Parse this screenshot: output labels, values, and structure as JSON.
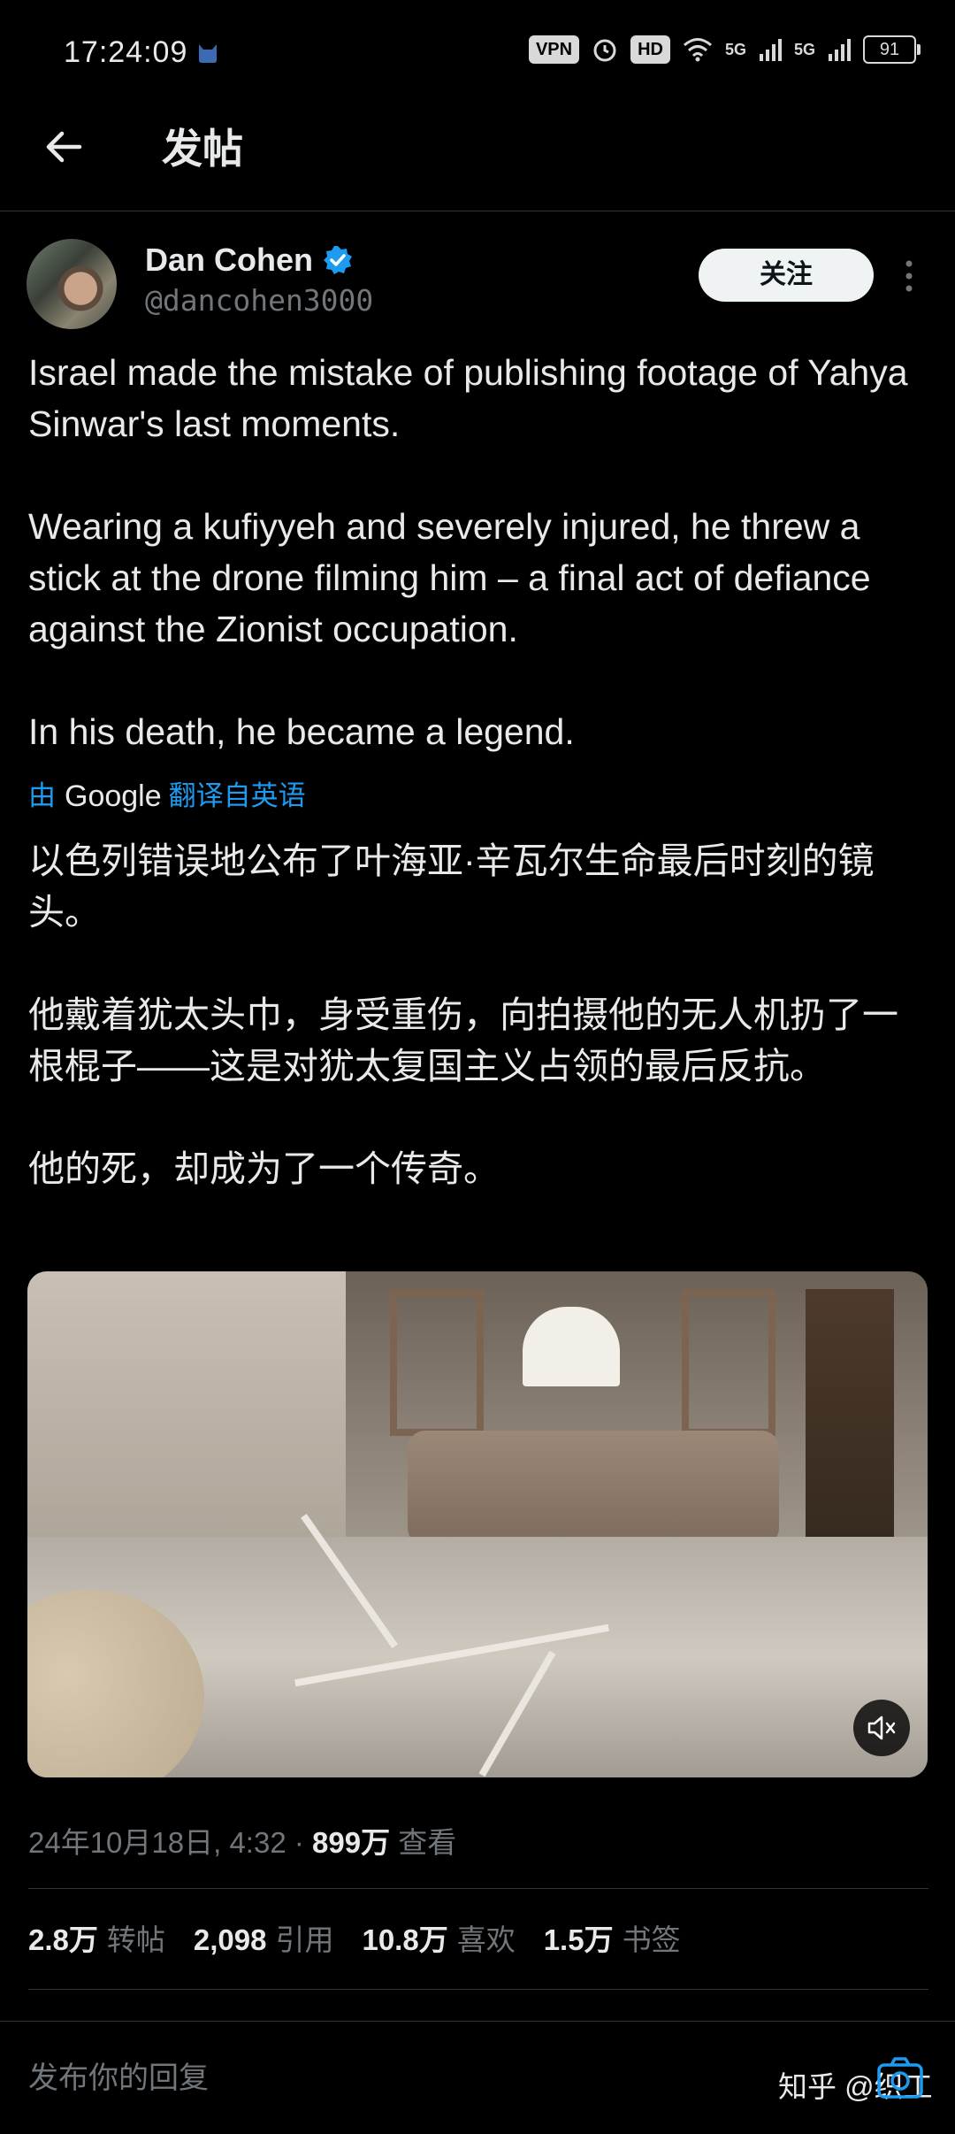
{
  "status_bar": {
    "time": "17:24:09",
    "vpn": "VPN",
    "hd": "HD",
    "signal1": "5G",
    "signal2": "5G",
    "battery": "91"
  },
  "header": {
    "title": "发帖"
  },
  "author": {
    "name": "Dan Cohen",
    "handle": "@dancohen3000",
    "follow_label": "关注"
  },
  "tweet": {
    "paragraphs": [
      "Israel made the mistake of publishing footage of Yahya Sinwar's last moments.",
      "Wearing a kufiyyeh and severely injured, he threw a stick at the drone filming him – a final act of defiance against the Zionist occupation.",
      "In his death, he became a legend."
    ]
  },
  "translation": {
    "prefix": "由",
    "brand": "Google",
    "suffix": "翻译自英语",
    "paragraphs": [
      "以色列错误地公布了叶海亚·辛瓦尔生命最后时刻的镜头。",
      "他戴着犹太头巾，身受重伤，向拍摄他的无人机扔了一根棍子——这是对犹太复国主义占领的最后反抗。",
      "他的死，却成为了一个传奇。"
    ]
  },
  "meta": {
    "date": "24年10月18日, 4:32 · ",
    "views_count": "899万",
    "views_label": " 查看"
  },
  "stats": [
    {
      "count": "2.8万",
      "label": "转帖"
    },
    {
      "count": "2,098",
      "label": "引用"
    },
    {
      "count": "10.8万",
      "label": "喜欢"
    },
    {
      "count": "1.5万",
      "label": "书签"
    }
  ],
  "reply": {
    "placeholder": "发布你的回复"
  },
  "watermark": "知乎 @织工",
  "colors": {
    "background": "#000000",
    "text": "#e7e9ea",
    "muted": "#71767b",
    "accent": "#1d9bf0"
  },
  "icons": [
    "back-arrow-icon",
    "verified-badge-icon",
    "more-icon",
    "mute-icon",
    "camera-icon",
    "alarm-icon",
    "wifi-icon"
  ]
}
